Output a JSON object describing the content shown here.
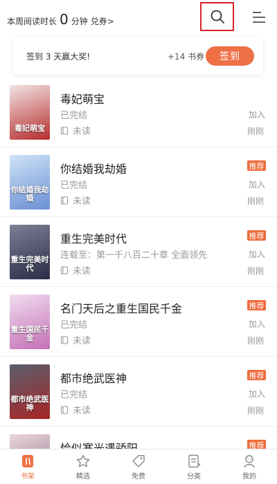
{
  "header": {
    "reading_prefix": "本周阅读时长",
    "reading_minutes": "0",
    "reading_unit": "分钟",
    "redeem_label": "兑券>",
    "search_icon": "search-icon",
    "menu_icon": "menu-icon"
  },
  "checkin": {
    "text": "签到 3 天赢大奖!",
    "reward": "+14 书券",
    "button_label": "签到"
  },
  "books": [
    {
      "title": "毒妃萌宝",
      "status": "已完结",
      "read_state": "未读",
      "add_label": "加入",
      "time": "刚刚",
      "recommended": false,
      "cover_text": "毒妃萌宝",
      "cover_colors": [
        "#f2e4e4",
        "#b72d2d"
      ]
    },
    {
      "title": "你结婚我劫婚",
      "status": "已完结",
      "read_state": "未读",
      "add_label": "加入",
      "time": "刚刚",
      "recommended": true,
      "badge": "推荐",
      "cover_text": "你结婚我劫婚",
      "cover_colors": [
        "#cfe4f7",
        "#6a8fd4"
      ]
    },
    {
      "title": "重生完美时代",
      "status": "连载至：第一千八百二十章 全面领先",
      "read_state": "未读",
      "add_label": "加入",
      "time": "刚刚",
      "recommended": true,
      "badge": "推荐",
      "cover_text": "重生完美时代",
      "cover_colors": [
        "#7d7f96",
        "#2b2d48"
      ]
    },
    {
      "title": "名门天后之重生国民千金",
      "status": "已完结",
      "read_state": "未读",
      "add_label": "加入",
      "time": "刚刚",
      "recommended": true,
      "badge": "推荐",
      "cover_text": "重生国民千金",
      "cover_colors": [
        "#f1dcef",
        "#c46fb6"
      ]
    },
    {
      "title": "都市绝武医神",
      "status": "已完结",
      "read_state": "未读",
      "add_label": "加入",
      "time": "刚刚",
      "recommended": true,
      "badge": "推荐",
      "cover_text": "都市绝武医神",
      "cover_colors": [
        "#5a5f6e",
        "#a82525"
      ]
    },
    {
      "title": "恰似寒光遇骄阳",
      "status": "",
      "read_state": "",
      "add_label": "",
      "time": "",
      "recommended": true,
      "badge": "推荐",
      "cover_text": "",
      "cover_colors": [
        "#e9d7d7",
        "#8a6d8f"
      ]
    }
  ],
  "nav": [
    {
      "label": "书架",
      "icon": "bookshelf-icon",
      "active": true
    },
    {
      "label": "精选",
      "icon": "star-icon",
      "active": false
    },
    {
      "label": "免费",
      "icon": "tag-icon",
      "active": false
    },
    {
      "label": "分类",
      "icon": "category-icon",
      "active": false
    },
    {
      "label": "我的",
      "icon": "profile-icon",
      "active": false
    }
  ],
  "colors": {
    "accent": "#ee7045",
    "badge": "#ee6a3a",
    "highlight_border": "#d8232a"
  }
}
